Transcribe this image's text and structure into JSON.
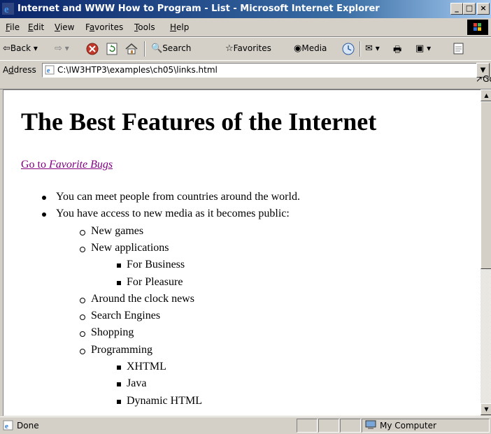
{
  "window": {
    "title": "Internet and WWW How to Program - List - Microsoft Internet Explorer",
    "controls": {
      "minimize": "_",
      "maximize": "□",
      "close": "×"
    }
  },
  "menu": {
    "items": [
      {
        "key": "F",
        "rest": "ile"
      },
      {
        "key": "E",
        "rest": "dit"
      },
      {
        "key": "V",
        "rest": "iew"
      },
      {
        "pre": "F",
        "key": "a",
        "rest": "vorites"
      },
      {
        "key": "T",
        "rest": "ools"
      },
      {
        "key": "H",
        "rest": "elp"
      }
    ]
  },
  "toolbar": {
    "back": "Back",
    "search": "Search",
    "favorites": "Favorites",
    "media": "Media"
  },
  "address": {
    "label_key": "d",
    "label_pre": "A",
    "label_rest": "dress",
    "value": "C:\\IW3HTP3\\examples\\ch05\\links.html",
    "go": "Go"
  },
  "page": {
    "heading": "The Best Features of the Internet",
    "link_prefix": "Go to ",
    "link_italic": "Favorite Bugs",
    "list": [
      {
        "level": 1,
        "text": "You can meet people from countries around the world."
      },
      {
        "level": 1,
        "text": "You have access to new media as it becomes public:"
      },
      {
        "level": 2,
        "text": "New games"
      },
      {
        "level": 2,
        "text": "New applications"
      },
      {
        "level": 3,
        "text": "For Business"
      },
      {
        "level": 3,
        "text": "For Pleasure"
      },
      {
        "level": 2,
        "text": "Around the clock news"
      },
      {
        "level": 2,
        "text": "Search Engines"
      },
      {
        "level": 2,
        "text": "Shopping"
      },
      {
        "level": 2,
        "text": "Programming"
      },
      {
        "level": 3,
        "text": "XHTML"
      },
      {
        "level": 3,
        "text": "Java"
      },
      {
        "level": 3,
        "text": "Dynamic HTML"
      }
    ]
  },
  "status": {
    "text": "Done",
    "zone": "My Computer"
  },
  "colors": {
    "titlebar_start": "#0a246a",
    "titlebar_end": "#a6caf0",
    "visited_link": "#800080",
    "chrome": "#d4d0c8"
  }
}
